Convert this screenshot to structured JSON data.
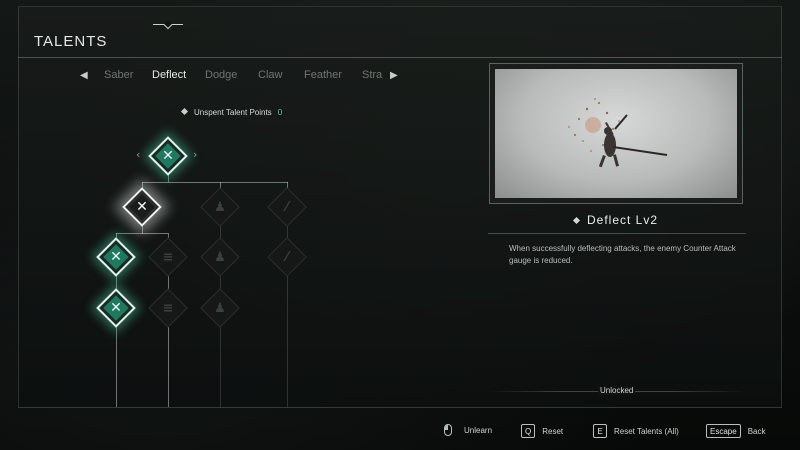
{
  "header": {
    "title": "TALENTS"
  },
  "tabs": {
    "items": [
      {
        "label": "Saber"
      },
      {
        "label": "Deflect"
      },
      {
        "label": "Dodge"
      },
      {
        "label": "Claw"
      },
      {
        "label": "Feather"
      },
      {
        "label": "Stra"
      }
    ],
    "active": "Deflect"
  },
  "points": {
    "label": "Unspent Talent Points",
    "value": "0"
  },
  "skill": {
    "name": "Deflect Lv2",
    "description": "When successfully deflecting attacks, the enemy Counter Attack gauge is reduced.",
    "status": "Unlocked"
  },
  "footer": {
    "unlearn": {
      "label": "Unlearn"
    },
    "reset": {
      "key": "Q",
      "label": "Reset"
    },
    "reset_all": {
      "key": "E",
      "label": "Reset Talents (All)"
    },
    "back": {
      "key": "Escape",
      "label": "Back"
    }
  },
  "colors": {
    "accent": "#1e7a5e",
    "glow": "#46c8a0",
    "points_value": "#5ec9a6"
  },
  "icons": {
    "learned": "crossed-blades-icon",
    "locked_a": "figure-icon",
    "locked_b": "feather-slash-icon"
  }
}
